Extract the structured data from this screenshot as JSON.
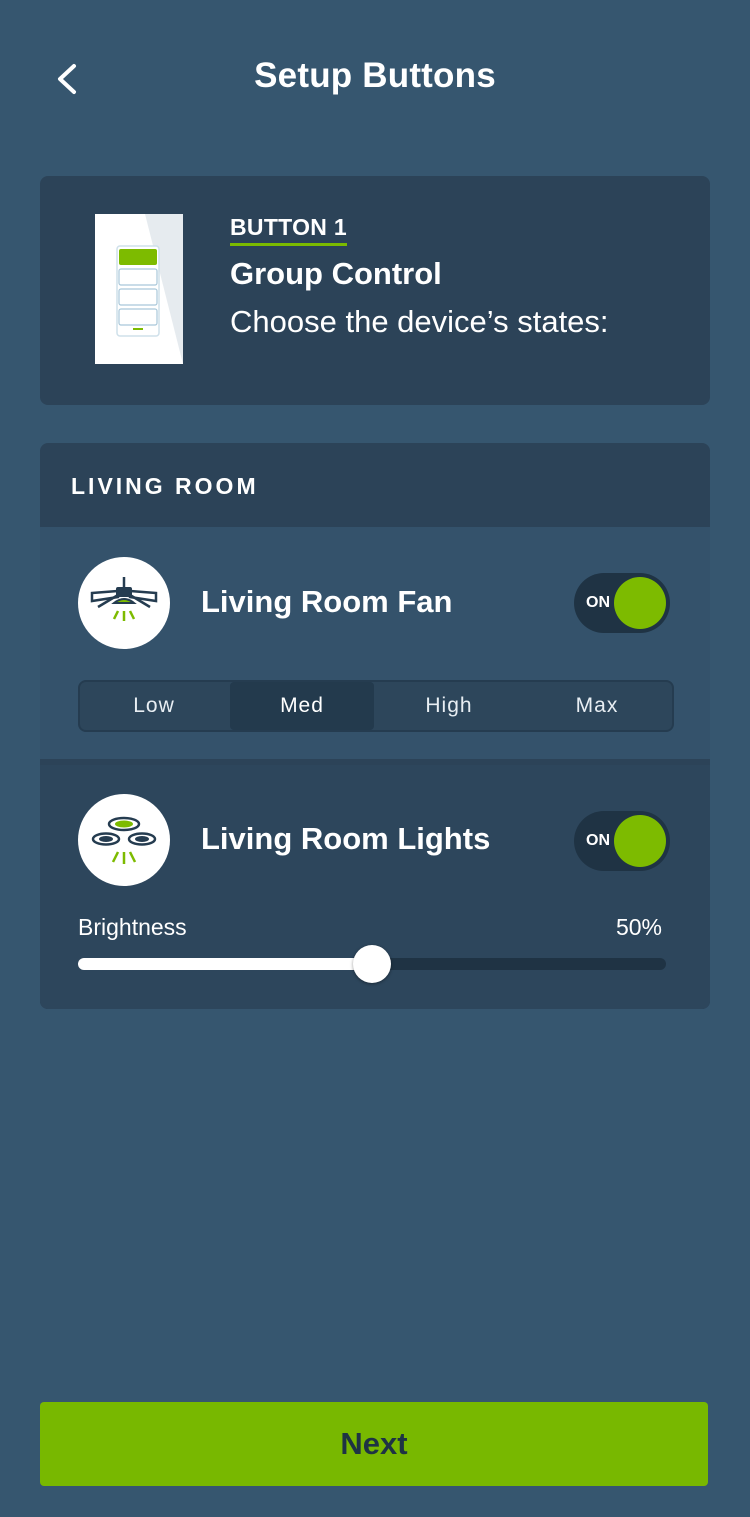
{
  "header": {
    "title": "Setup Buttons",
    "back_icon": "chevron-left-icon"
  },
  "button_card": {
    "label": "BUTTON 1",
    "title": "Group Control",
    "subtitle": "Choose the device’s states:"
  },
  "room": {
    "name": "LIVING ROOM",
    "devices": [
      {
        "name": "Living Room Fan",
        "icon": "ceiling-fan-icon",
        "toggle_label": "ON",
        "speeds": [
          "Low",
          "Med",
          "High",
          "Max"
        ],
        "selected_speed": "Med"
      },
      {
        "name": "Living Room Lights",
        "icon": "ceiling-lights-icon",
        "toggle_label": "ON",
        "brightness_label": "Brightness",
        "brightness_value": "50%",
        "brightness_fraction": 0.5
      }
    ]
  },
  "footer": {
    "next_label": "Next"
  },
  "colors": {
    "background": "#36566f",
    "card": "#2c4358",
    "accent": "#7dbb00"
  }
}
